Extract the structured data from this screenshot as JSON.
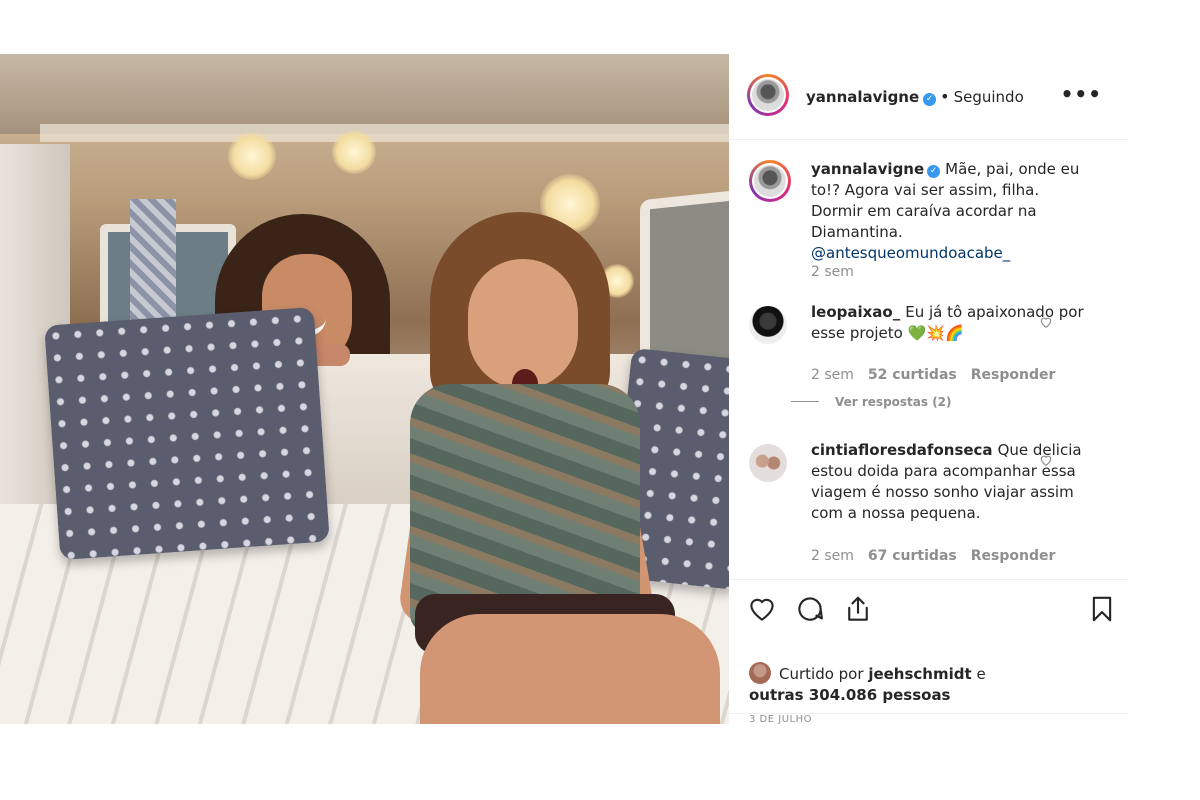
{
  "post": {
    "author": {
      "username": "yannalavigne",
      "verified_icon": "verified-badge-icon",
      "follow_status": "Seguindo",
      "separator": "•"
    },
    "more_icon": "more-options-icon",
    "more_label": "•••",
    "caption": {
      "username": "yannalavigne",
      "text": "Mãe, pai, onde eu to!? Agora vai ser assim, filha. Dormir em caraíva acordar na Diamantina.",
      "mention": "@antesqueomundoacabe_",
      "time": "2 sem"
    },
    "comments": [
      {
        "username": "leopaixao_",
        "text": "Eu já tô apaixonado por esse projeto",
        "emojis": "💚💥🌈",
        "time": "2 sem",
        "likes": "52 curtidas",
        "reply_label": "Responder",
        "view_replies": "Ver respostas (2)"
      },
      {
        "username": "cintiafloresdafonseca",
        "text": "Que delicia estou doida para acompanhar essa viagem é nosso sonho viajar assim com a nossa pequena.",
        "time": "2 sem",
        "likes": "67 curtidas",
        "reply_label": "Responder"
      }
    ],
    "actions": {
      "like_icon": "heart-icon",
      "comment_icon": "comment-icon",
      "share_icon": "share-icon",
      "save_icon": "bookmark-icon"
    },
    "liked_by": {
      "prefix": "Curtido por",
      "user": "jeehschmidt",
      "connector": "e",
      "others": "outras 304.086 pessoas"
    },
    "date": "3 DE JULHO"
  },
  "colors": {
    "text": "#262626",
    "muted": "#8e8e8e",
    "verified": "#3897f0",
    "mention": "#003569",
    "border": "#efefef"
  }
}
